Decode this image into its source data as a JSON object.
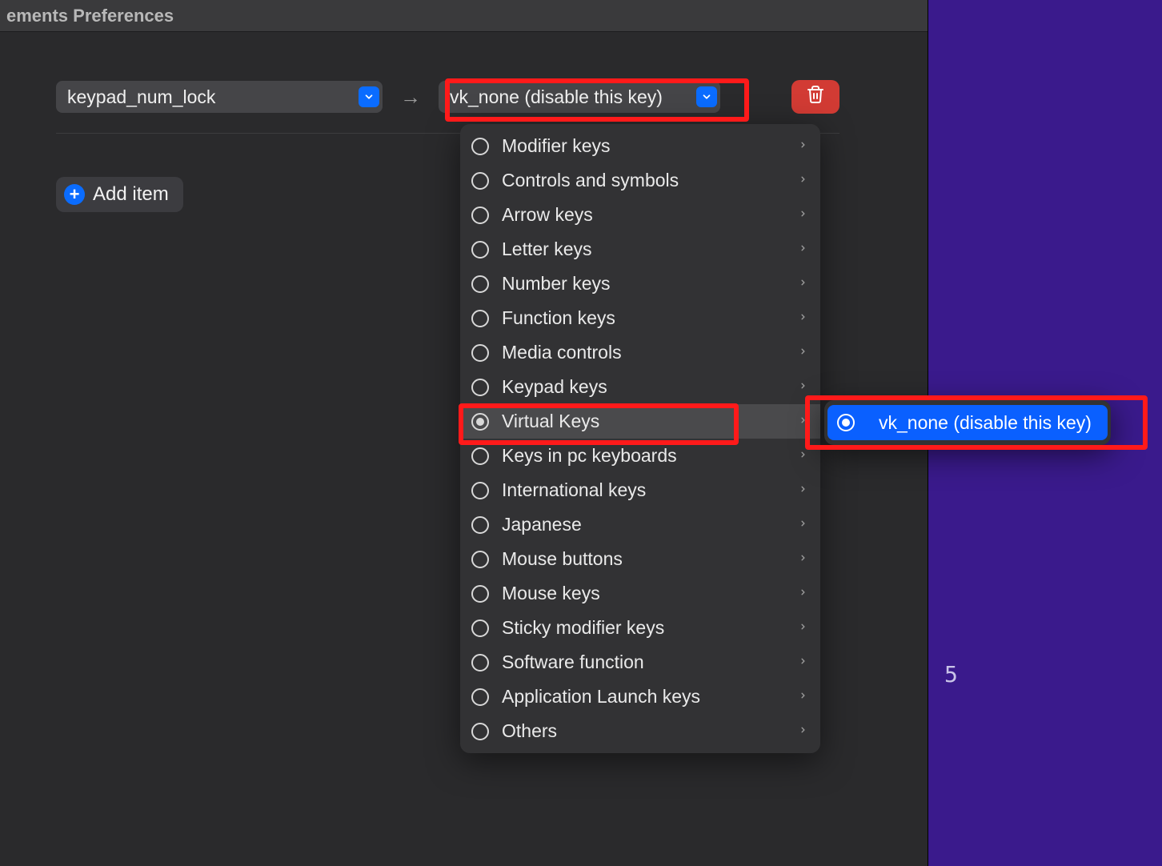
{
  "window": {
    "title_fragment": "ements Preferences"
  },
  "mapping": {
    "from_key": "keypad_num_lock",
    "to_key": "vk_none (disable this key)",
    "arrow": "→"
  },
  "add_item_label": "Add item",
  "menu": {
    "items": [
      {
        "label": "Modifier keys",
        "selected": false
      },
      {
        "label": "Controls and symbols",
        "selected": false
      },
      {
        "label": "Arrow keys",
        "selected": false
      },
      {
        "label": "Letter keys",
        "selected": false
      },
      {
        "label": "Number keys",
        "selected": false
      },
      {
        "label": "Function keys",
        "selected": false
      },
      {
        "label": "Media controls",
        "selected": false
      },
      {
        "label": "Keypad keys",
        "selected": false
      },
      {
        "label": "Virtual Keys",
        "selected": true
      },
      {
        "label": "Keys in pc keyboards",
        "selected": false
      },
      {
        "label": "International keys",
        "selected": false
      },
      {
        "label": "Japanese",
        "selected": false
      },
      {
        "label": "Mouse buttons",
        "selected": false
      },
      {
        "label": "Mouse keys",
        "selected": false
      },
      {
        "label": "Sticky modifier keys",
        "selected": false
      },
      {
        "label": "Software function",
        "selected": false
      },
      {
        "label": "Application Launch keys",
        "selected": false
      },
      {
        "label": "Others",
        "selected": false
      }
    ]
  },
  "submenu": {
    "items": [
      {
        "label": "vk_none (disable this key)",
        "selected": true
      }
    ]
  },
  "bg_char": "5",
  "colors": {
    "accent": "#0a6cff",
    "danger": "#d23b34",
    "highlight": "#ff1a1a",
    "desktop_bg": "#3a1a8c"
  }
}
